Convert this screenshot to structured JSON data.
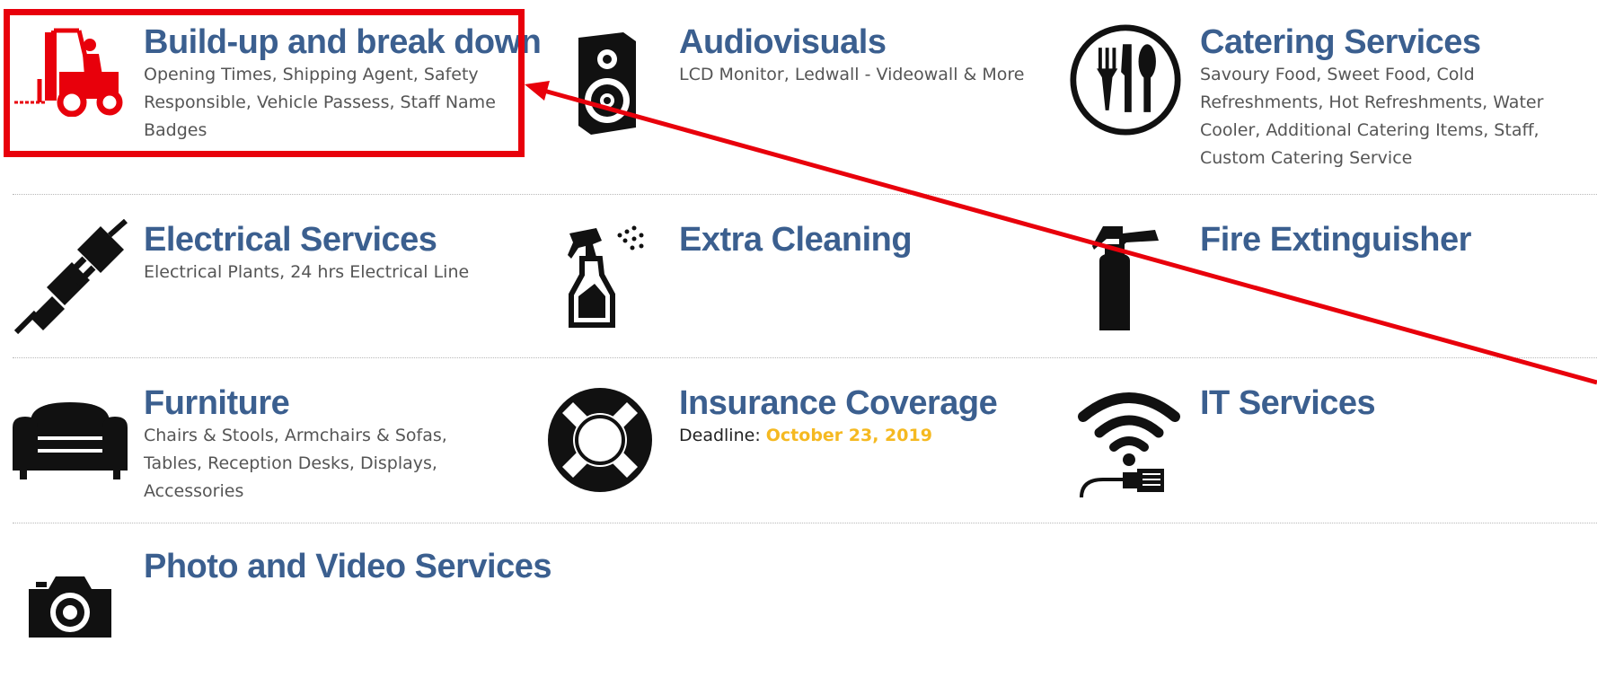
{
  "services": [
    {
      "title": "Build-up and break down",
      "description": "Opening Times, Shipping Agent, Safety Responsible, Vehicle Passess, Staff Name Badges",
      "icon": "forklift-icon",
      "icon_color": "#e8000b"
    },
    {
      "title": "Audiovisuals",
      "description": "LCD Monitor, Ledwall - Videowall & More",
      "icon": "speaker-icon"
    },
    {
      "title": "Catering Services",
      "description": "Savoury Food, Sweet Food, Cold Refreshments, Hot Refreshments, Water Cooler, Additional Catering Items, Staff, Custom Catering Service",
      "icon": "cutlery-icon"
    },
    {
      "title": "Electrical Services",
      "description": "Electrical Plants, 24 hrs Electrical Line",
      "icon": "plug-icon"
    },
    {
      "title": "Extra Cleaning",
      "description": "",
      "icon": "spray-bottle-icon"
    },
    {
      "title": "Fire Extinguisher",
      "description": "",
      "icon": "fire-extinguisher-icon"
    },
    {
      "title": "Furniture",
      "description": "Chairs & Stools, Armchairs & Sofas, Tables, Reception Desks, Displays, Accessories",
      "icon": "sofa-icon"
    },
    {
      "title": "Insurance Coverage",
      "deadline_label": "Deadline:",
      "deadline_value": "October 23, 2019",
      "icon": "lifebuoy-icon"
    },
    {
      "title": "IT Services",
      "description": "",
      "icon": "wifi-network-icon"
    },
    {
      "title": "Photo and Video Services",
      "description": "",
      "icon": "camera-icon"
    }
  ],
  "colors": {
    "title": "#3b5f8f",
    "description": "#555555",
    "deadline": "#f5b921",
    "annotation": "#e8000b"
  }
}
